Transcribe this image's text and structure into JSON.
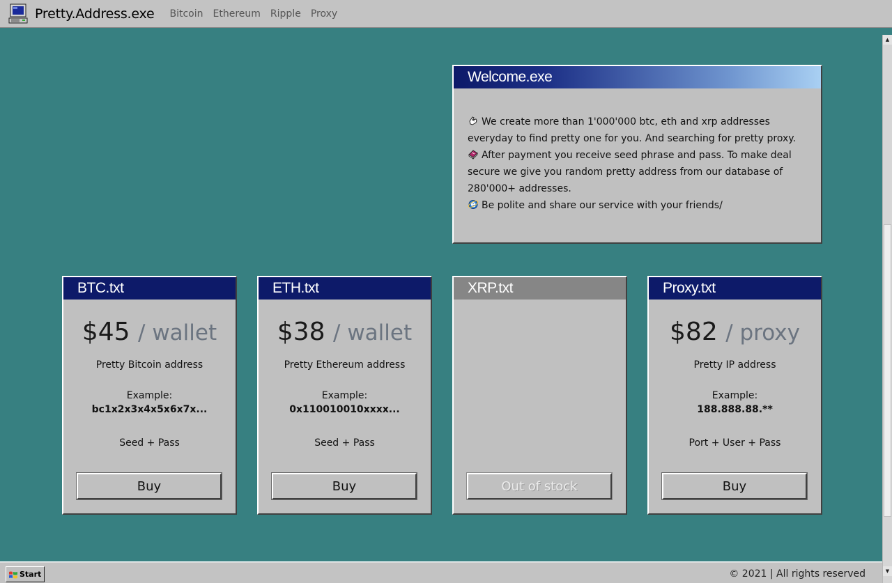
{
  "header": {
    "brand_icon": "computer-icon",
    "brand_name": "Pretty.Address.exe",
    "nav": [
      {
        "label": "Bitcoin"
      },
      {
        "label": "Ethereum"
      },
      {
        "label": "Ripple"
      },
      {
        "label": "Proxy"
      }
    ]
  },
  "welcome": {
    "title": "Welcome.exe",
    "paragraphs": [
      {
        "icon": "hand-pointer-icon",
        "text": "We create more than 1'000'000 btc, eth and xrp addresses everyday to find pretty one for you. And searching for pretty proxy."
      },
      {
        "icon": "book-icon",
        "text": "After payment you receive seed phrase and pass. To make deal secure we give you random pretty address from our database of 280'000+ addresses."
      },
      {
        "icon": "internet-explorer-icon",
        "text": "Be polite and share our service with your friends/"
      }
    ]
  },
  "products": [
    {
      "title": "BTC.txt",
      "price": "$45",
      "unit": "/ wallet",
      "desc": "Pretty Bitcoin address",
      "example_label": "Example:",
      "example_value": "bc1x2x3x4x5x6x7x...",
      "note": "Seed + Pass",
      "button": "Buy",
      "in_stock": true
    },
    {
      "title": "ETH.txt",
      "price": "$38",
      "unit": "/ wallet",
      "desc": "Pretty Ethereum address",
      "example_label": "Example:",
      "example_value": "0x110010010xxxx...",
      "note": "Seed + Pass",
      "button": "Buy",
      "in_stock": true
    },
    {
      "title": "XRP.txt",
      "price": "",
      "unit": "",
      "desc": "",
      "example_label": "",
      "example_value": "",
      "note": "",
      "button": "Out of stock",
      "in_stock": false
    },
    {
      "title": "Proxy.txt",
      "price": "$82",
      "unit": "/ proxy",
      "desc": "Pretty IP address",
      "example_label": "Example:",
      "example_value": "188.888.88.**",
      "note": "Port + User + Pass",
      "button": "Buy",
      "in_stock": true
    }
  ],
  "taskbar": {
    "start_label": "Start",
    "copyright": "© 2021 | All rights reserved"
  },
  "colors": {
    "desktop": "#378081",
    "titlebar": "#0d1a69",
    "titlebar_disabled": "#868686",
    "window": "#c0c0c0"
  }
}
